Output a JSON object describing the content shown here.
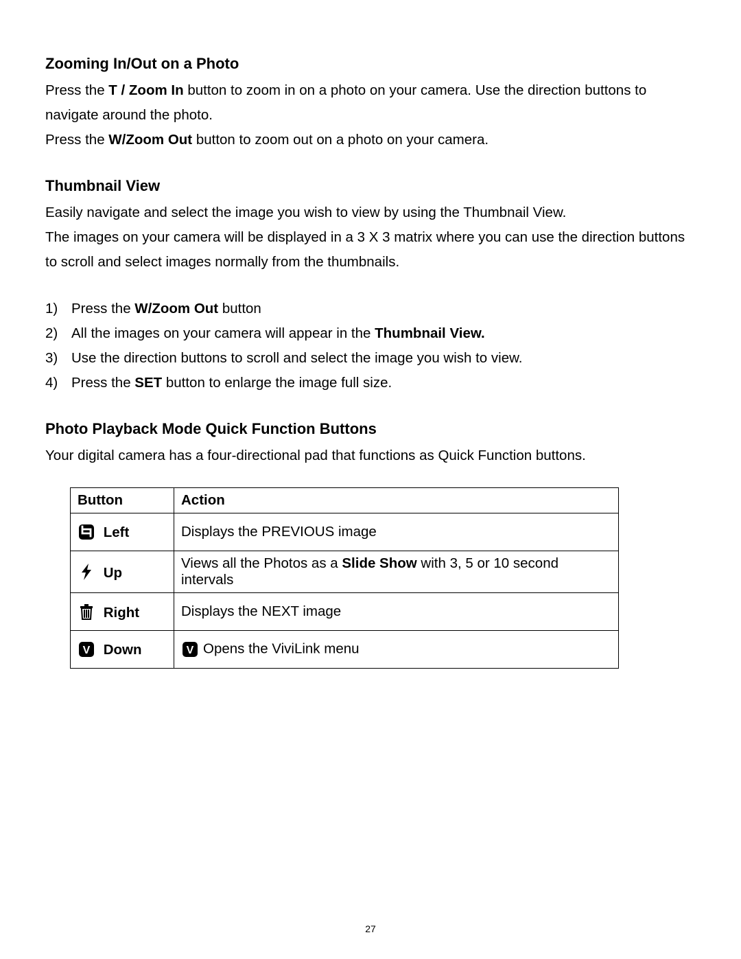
{
  "page_number": "27",
  "section1": {
    "heading": "Zooming In/Out on a Photo",
    "p1_pre": "Press the ",
    "p1_bold": "T / Zoom In",
    "p1_post": " button to zoom in on a photo on your camera. Use the direction buttons to navigate around the photo.",
    "p2_pre": "Press the ",
    "p2_bold": "W/Zoom Out",
    "p2_post": " button to zoom out on a photo on your camera."
  },
  "section2": {
    "heading": "Thumbnail View",
    "p1": "Easily navigate and select the image you wish to view by using the Thumbnail View.",
    "p2": "The images on your camera will be displayed in a 3 X 3 matrix where you can use the direction buttons to scroll and select images normally from the thumbnails.",
    "li1_pre": "Press the ",
    "li1_bold": "W/Zoom Out",
    "li1_post": " button",
    "li2_pre": "All the images on your camera will appear in the ",
    "li2_bold": "Thumbnail View.",
    "li3": "Use the direction buttons to scroll and select the image you wish to view.",
    "li4_pre": "Press the ",
    "li4_bold": "SET",
    "li4_post": " button to enlarge the image full size."
  },
  "section3": {
    "heading": "Photo Playback Mode Quick Function Buttons",
    "p1": "Your digital camera has a four-directional pad that functions as Quick Function buttons.",
    "table": {
      "th_button": "Button",
      "th_action": "Action",
      "rows": {
        "left": {
          "label": "Left",
          "action": "Displays the PREVIOUS image"
        },
        "up": {
          "label": "Up",
          "action_pre": "Views all the Photos as a ",
          "action_bold": "Slide Show",
          "action_post": " with 3, 5 or 10 second intervals"
        },
        "right": {
          "label": "Right",
          "action": "Displays the NEXT image"
        },
        "down": {
          "label": "Down",
          "action": "Opens the ViviLink menu"
        }
      }
    }
  }
}
